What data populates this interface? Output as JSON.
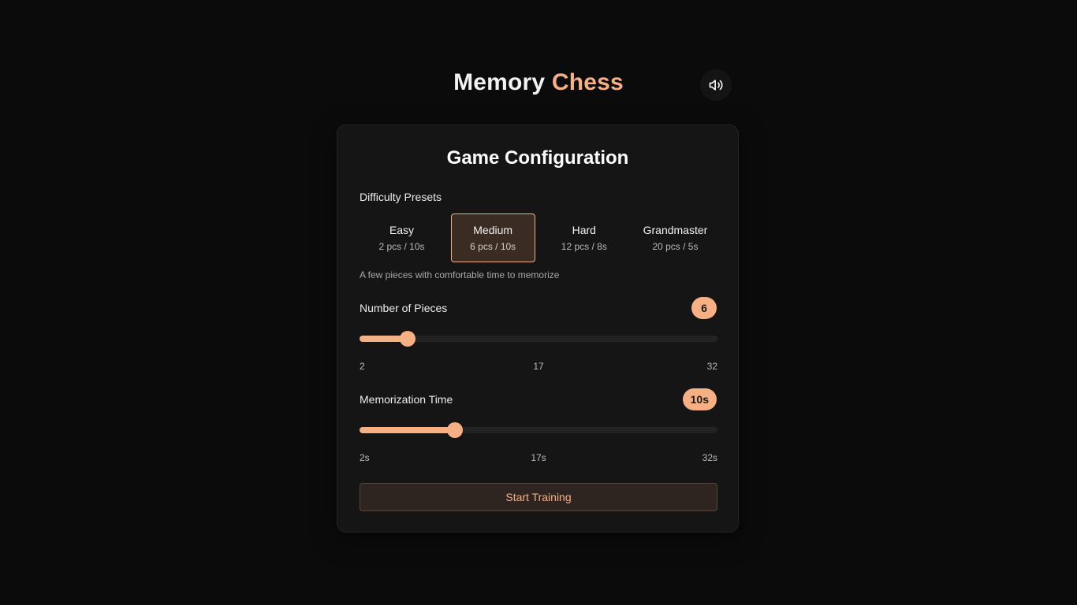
{
  "header": {
    "title_part1": "Memory",
    "title_part2": "Chess",
    "sound_icon": "speaker-volume-icon"
  },
  "config": {
    "title": "Game Configuration",
    "presets_label": "Difficulty Presets",
    "presets": [
      {
        "name": "Easy",
        "detail": "2 pcs / 10s",
        "selected": false
      },
      {
        "name": "Medium",
        "detail": "6 pcs / 10s",
        "selected": true
      },
      {
        "name": "Hard",
        "detail": "12 pcs / 8s",
        "selected": false
      },
      {
        "name": "Grandmaster",
        "detail": "20 pcs / 5s",
        "selected": false
      }
    ],
    "preset_description": "A few pieces with comfortable time to memorize",
    "pieces": {
      "label": "Number of Pieces",
      "value": 6,
      "value_display": "6",
      "min": 2,
      "max": 32,
      "tick_min": "2",
      "tick_mid": "17",
      "tick_max": "32"
    },
    "time": {
      "label": "Memorization Time",
      "value": 10,
      "value_display": "10s",
      "min": 2,
      "max": 32,
      "tick_min": "2s",
      "tick_mid": "17s",
      "tick_max": "32s"
    },
    "start_label": "Start Training"
  },
  "colors": {
    "accent": "#f6b083",
    "background": "#0b0b0b",
    "card": "#151515"
  }
}
